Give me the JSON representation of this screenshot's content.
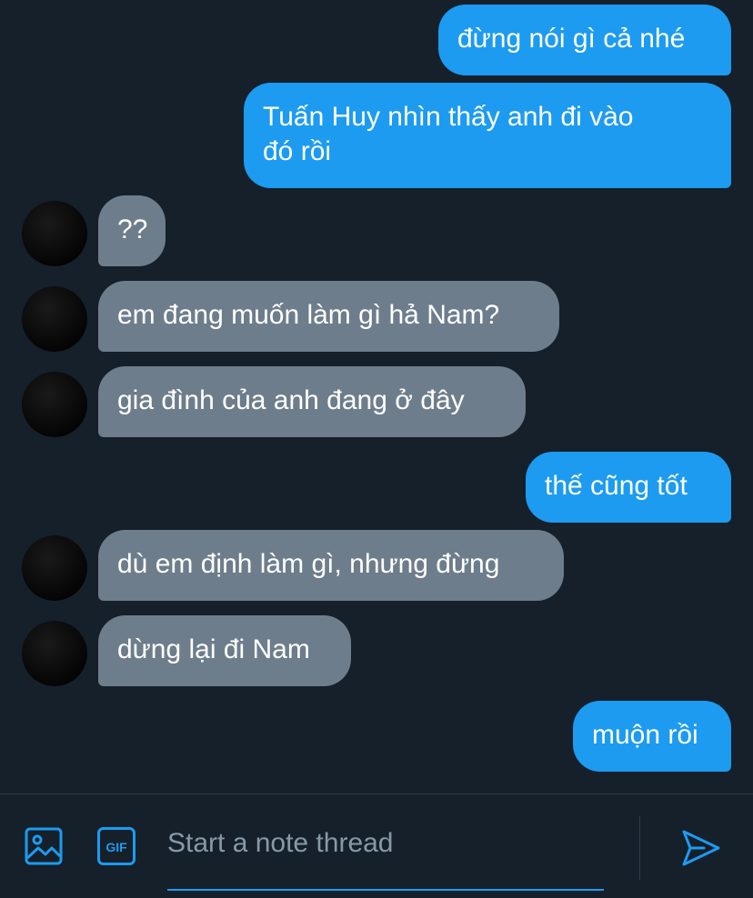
{
  "messages": [
    {
      "direction": "out",
      "text": "đừng nói gì cả nhé"
    },
    {
      "direction": "out",
      "text": "Tuấn Huy nhìn thấy anh đi vào\nđó rồi"
    },
    {
      "direction": "in",
      "text": "??"
    },
    {
      "direction": "in",
      "text": "em đang muốn làm gì hả Nam?"
    },
    {
      "direction": "in",
      "text": "gia đình của anh đang ở đây"
    },
    {
      "direction": "out",
      "text": "thế cũng tốt"
    },
    {
      "direction": "in",
      "text": "dù em định làm gì, nhưng đừng"
    },
    {
      "direction": "in",
      "text": "dừng lại đi Nam"
    },
    {
      "direction": "out",
      "text": "muộn rồi"
    }
  ],
  "composer": {
    "placeholder": "Start a note thread",
    "gif_label": "GIF",
    "image_icon": "image-icon",
    "send_icon": "send-icon"
  },
  "colors": {
    "background": "#15202b",
    "outgoing_bubble": "#1d9bf0",
    "incoming_bubble": "#6e7d8b",
    "accent": "#1d9bf0"
  }
}
